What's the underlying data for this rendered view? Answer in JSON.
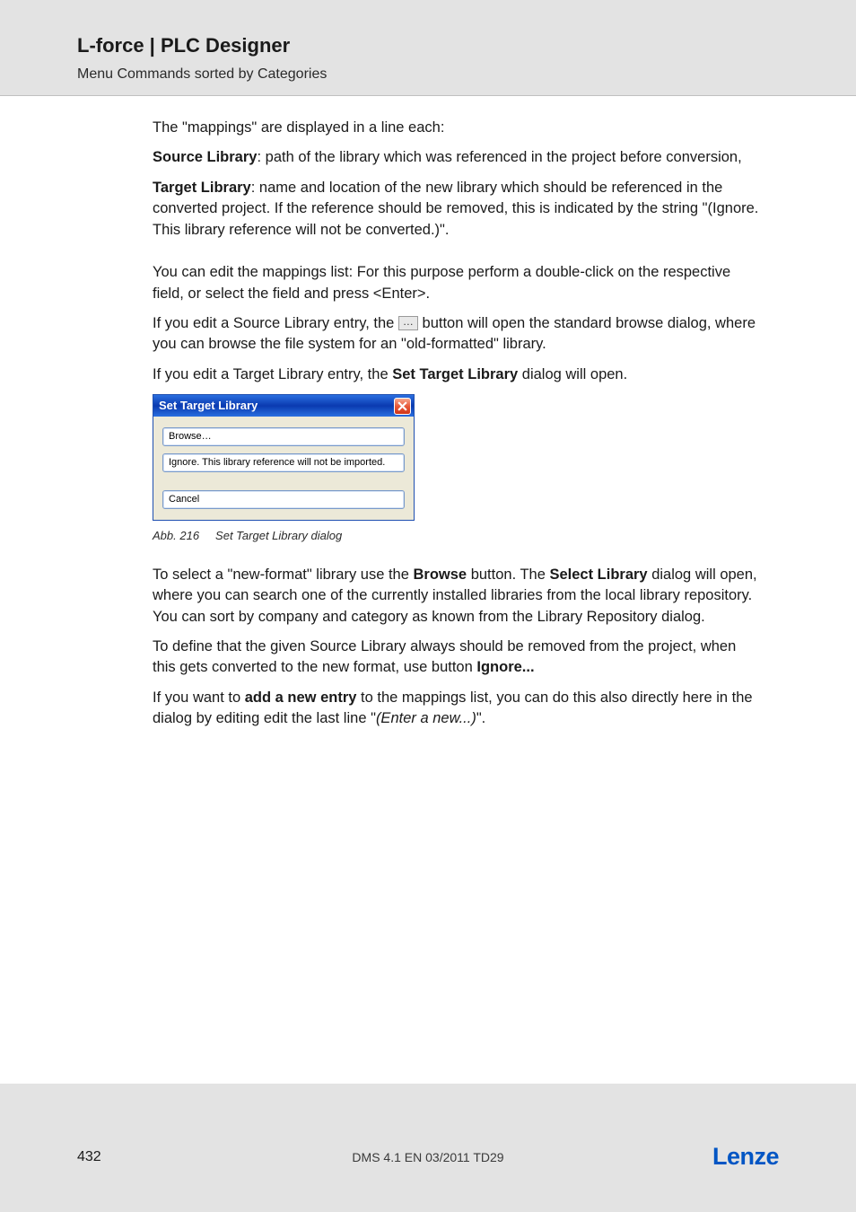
{
  "header": {
    "title": "L-force | PLC Designer",
    "subtitle": "Menu Commands sorted by Categories"
  },
  "body": {
    "p1": "The \"mappings\" are displayed in a line each:",
    "p2_bold": "Source Library",
    "p2_rest": ": path of the library which was referenced in the project before conversion,",
    "p3_bold": "Target Library",
    "p3_rest": ": name and location of the new library which should be referenced in the converted project.  If the reference should be removed, this is indicated by the string \"(Ignore. This library reference will not be converted.)\".",
    "p4": "You can edit the mappings list: For this purpose perform a double-click on the respective field, or select the field and press <Enter>.",
    "p5_a": "If you edit a Source Library entry, the ",
    "p5_b": "button will open the standard browse dialog, where you can browse the file system for an \"old-formatted\" library.",
    "p6_a": "If you edit a Target Library entry, the ",
    "p6_bold": "Set Target Library",
    "p6_b": " dialog will open.",
    "caption_num": "Abb. 216",
    "caption_text": "Set Target Library dialog",
    "p7_a": "To select a \"new-format\" library use the ",
    "p7_b1": "Browse",
    "p7_b": " button. The ",
    "p7_b2": "Select Library",
    "p7_c": " dialog will open, where you can search one of the currently installed libraries from the local library repository. You can sort by company and category as known from the Library Repository dialog.",
    "p8_a": "To define that the given Source Library always should be removed from the project, when this gets converted to the new format, use button ",
    "p8_bold": "Ignore...",
    "p9_a": "If you want to ",
    "p9_bold": "add a new entry",
    "p9_b": " to the mappings list, you can do this also directly here in the dialog by editing edit the last line \"",
    "p9_italic": "(Enter a new...)",
    "p9_c": "\"."
  },
  "dialog": {
    "title": "Set Target Library",
    "browse": "Browse…",
    "ignore": "Ignore. This library reference will not be imported.",
    "cancel": "Cancel"
  },
  "footer": {
    "page": "432",
    "doc": "DMS 4.1 EN 03/2011 TD29",
    "logo": "Lenze"
  }
}
